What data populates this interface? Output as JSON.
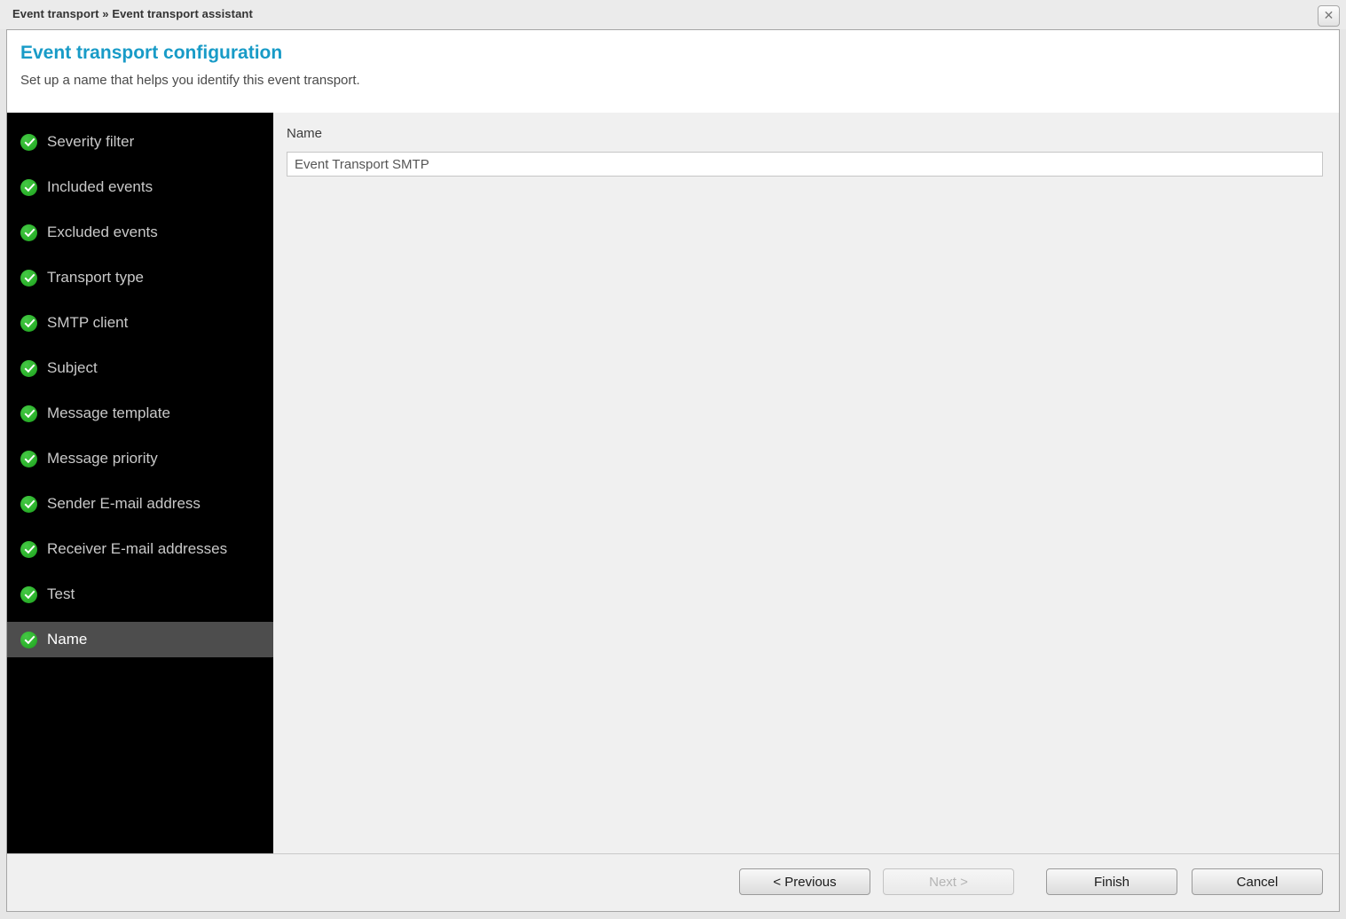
{
  "titlebar": {
    "breadcrumb": "Event transport » Event transport assistant",
    "close_icon_glyph": "✕"
  },
  "header": {
    "title": "Event transport configuration",
    "subtitle": "Set up a name that helps you identify this event transport."
  },
  "sidebar": {
    "steps": [
      {
        "label": "Severity filter",
        "completed": true,
        "active": false
      },
      {
        "label": "Included events",
        "completed": true,
        "active": false
      },
      {
        "label": "Excluded events",
        "completed": true,
        "active": false
      },
      {
        "label": "Transport type",
        "completed": true,
        "active": false
      },
      {
        "label": "SMTP client",
        "completed": true,
        "active": false
      },
      {
        "label": "Subject",
        "completed": true,
        "active": false
      },
      {
        "label": "Message template",
        "completed": true,
        "active": false
      },
      {
        "label": "Message priority",
        "completed": true,
        "active": false
      },
      {
        "label": "Sender E-mail address",
        "completed": true,
        "active": false
      },
      {
        "label": "Receiver E-mail addresses",
        "completed": true,
        "active": false
      },
      {
        "label": "Test",
        "completed": true,
        "active": false
      },
      {
        "label": "Name",
        "completed": true,
        "active": true
      }
    ]
  },
  "main": {
    "field_label": "Name",
    "field_value": "Event Transport SMTP"
  },
  "footer": {
    "buttons": [
      {
        "label": "< Previous",
        "enabled": true
      },
      {
        "label": "Next >",
        "enabled": false
      },
      {
        "label": "Finish",
        "enabled": true
      },
      {
        "label": "Cancel",
        "enabled": true
      }
    ]
  },
  "colors": {
    "accent_blue": "#189bc7",
    "check_green": "#2eb52e",
    "sidebar_bg": "#000000",
    "active_step_bg": "#4d4d4d",
    "content_bg": "#f0f0f0"
  }
}
